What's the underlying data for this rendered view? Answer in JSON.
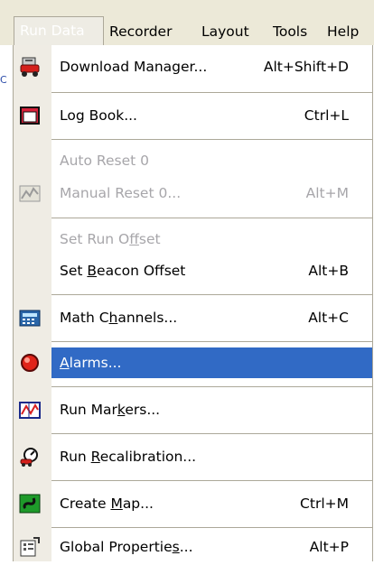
{
  "menubar": {
    "items": [
      "Run Data",
      "Recorder",
      "Layout",
      "Tools",
      "Help"
    ]
  },
  "side_text": "C",
  "menu": {
    "items": [
      {
        "pre": "Download Manager...",
        "mn": "",
        "post": "",
        "shortcut": "Alt+Shift+D",
        "icon": "download-manager-icon",
        "disabled": false
      },
      {
        "pre": "Log Book...",
        "mn": "",
        "post": "",
        "shortcut": "Ctrl+L",
        "icon": "log-book-icon",
        "disabled": false
      },
      {
        "pre": "Auto Reset 0",
        "mn": "",
        "post": "",
        "shortcut": "",
        "icon": "",
        "disabled": true
      },
      {
        "pre": "Manual Reset 0...",
        "mn": "",
        "post": "",
        "shortcut": "Alt+M",
        "icon": "manual-reset-icon",
        "disabled": true
      },
      {
        "pre": "Set Run O",
        "mn": "f",
        "post": "fset",
        "shortcut": "",
        "icon": "",
        "disabled": true
      },
      {
        "pre": "Set ",
        "mn": "B",
        "post": "eacon Offset",
        "shortcut": "Alt+B",
        "icon": "",
        "disabled": false
      },
      {
        "pre": "Math C",
        "mn": "h",
        "post": "annels...",
        "shortcut": "Alt+C",
        "icon": "math-channels-icon",
        "disabled": false
      },
      {
        "pre": "",
        "mn": "A",
        "post": "larms...",
        "shortcut": "",
        "icon": "alarms-icon",
        "disabled": false
      },
      {
        "pre": "Run Mar",
        "mn": "k",
        "post": "ers...",
        "shortcut": "",
        "icon": "run-markers-icon",
        "disabled": false
      },
      {
        "pre": "Run ",
        "mn": "R",
        "post": "ecalibration...",
        "shortcut": "",
        "icon": "recalibration-icon",
        "disabled": false
      },
      {
        "pre": "Create ",
        "mn": "M",
        "post": "ap...",
        "shortcut": "Ctrl+M",
        "icon": "create-map-icon",
        "disabled": false
      },
      {
        "pre": "Global Propertie",
        "mn": "s",
        "post": "...",
        "shortcut": "Alt+P",
        "icon": "global-properties-icon",
        "disabled": false
      }
    ],
    "highlighted_index": 7
  },
  "colors": {
    "highlight": "#316ac5",
    "menubar": "#ece9d8",
    "icon_column": "#efece4",
    "disabled_text": "#a7a6aa"
  }
}
